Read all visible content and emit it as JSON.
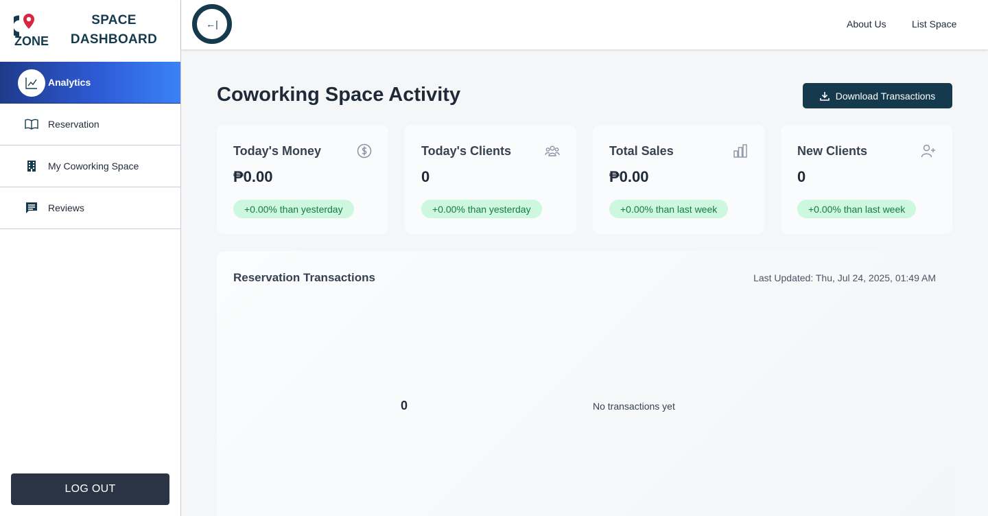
{
  "sidebar": {
    "brand_line1": "SPACE",
    "brand_line2": "DASHBOARD",
    "logo_text": "ZONE",
    "items": [
      {
        "label": "Analytics",
        "icon": "chart-line-icon"
      },
      {
        "label": "Reservation",
        "icon": "book-open-icon"
      },
      {
        "label": "My Coworking Space",
        "icon": "building-icon"
      },
      {
        "label": "Reviews",
        "icon": "chat-icon"
      }
    ],
    "logout_label": "LOG OUT"
  },
  "header": {
    "toggle_symbol": "←|",
    "links": [
      "About Us",
      "List Space"
    ]
  },
  "main": {
    "title": "Coworking Space Activity",
    "download_label": "Download Transactions",
    "cards": [
      {
        "title": "Today's Money",
        "value": "₱0.00",
        "badge": "+0.00% than yesterday",
        "icon": "dollar-circle-icon"
      },
      {
        "title": "Today's Clients",
        "value": "0",
        "badge": "+0.00% than yesterday",
        "icon": "users-icon"
      },
      {
        "title": "Total Sales",
        "value": "₱0.00",
        "badge": "+0.00% than last week",
        "icon": "bar-chart-icon"
      },
      {
        "title": "New Clients",
        "value": "0",
        "badge": "+0.00% than last week",
        "icon": "user-plus-icon"
      }
    ],
    "transactions": {
      "title": "Reservation Transactions",
      "last_updated": "Last Updated: Thu, Jul 24, 2025, 01:49 AM",
      "count": "0",
      "empty_text": "No transactions yet"
    }
  },
  "colors": {
    "brand_dark": "#163a4d",
    "active_gradient_start": "#1e3a8a",
    "active_gradient_end": "#3b82f6",
    "badge_bg": "#cdf7df",
    "badge_text": "#157a46",
    "logo_red": "#d7263d"
  }
}
